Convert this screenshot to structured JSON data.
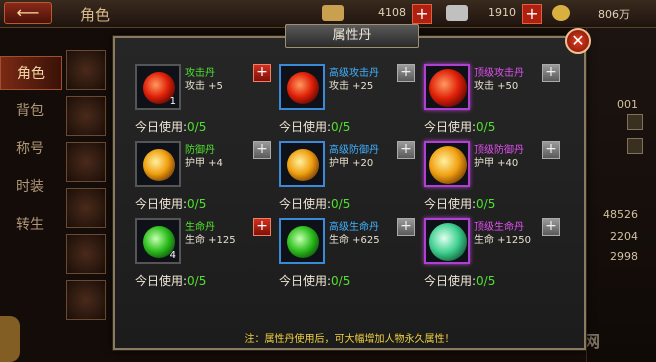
{
  "topbar": {
    "back_label": "⟵",
    "title": "角色",
    "resources": [
      {
        "icon": "gold-ingot-icon",
        "value": "4108"
      },
      {
        "icon": "silver-ingot-icon",
        "value": "1910"
      },
      {
        "icon": "copper-coin-icon",
        "value": "806万"
      }
    ],
    "plus_label": "+"
  },
  "sidenav": [
    "角色",
    "背包",
    "称号",
    "时装",
    "转生"
  ],
  "rightpanel": {
    "partial_text": "001",
    "numbers": [
      "48526",
      "2204",
      "2998"
    ]
  },
  "watermark": "九游手游网",
  "modal": {
    "title": "属性丹",
    "close_label": "✕",
    "usage_label": "今日使用:",
    "note": "注：属性丹使用后，可大幅增加人物永久属性！",
    "items": [
      {
        "name": "攻击丹",
        "stat": "攻击 +5",
        "usage": "0/5",
        "tier": "green",
        "orb": "red",
        "count": "1",
        "add": "red"
      },
      {
        "name": "高级攻击丹",
        "stat": "攻击 +25",
        "usage": "0/5",
        "tier": "blue",
        "orb": "red",
        "count": "",
        "add": "gray"
      },
      {
        "name": "顶级攻击丹",
        "stat": "攻击 +50",
        "usage": "0/5",
        "tier": "purple",
        "orb": "red",
        "count": "",
        "add": "gray"
      },
      {
        "name": "防御丹",
        "stat": "护甲 +4",
        "usage": "0/5",
        "tier": "green",
        "orb": "gold",
        "count": "",
        "add": "gray"
      },
      {
        "name": "高级防御丹",
        "stat": "护甲 +20",
        "usage": "0/5",
        "tier": "blue",
        "orb": "gold",
        "count": "",
        "add": "gray"
      },
      {
        "name": "顶级防御丹",
        "stat": "护甲 +40",
        "usage": "0/5",
        "tier": "purple",
        "orb": "gold",
        "count": "",
        "add": "gray"
      },
      {
        "name": "生命丹",
        "stat": "生命 +125",
        "usage": "0/5",
        "tier": "green",
        "orb": "green",
        "count": "4",
        "add": "red"
      },
      {
        "name": "高级生命丹",
        "stat": "生命 +625",
        "usage": "0/5",
        "tier": "blue",
        "orb": "green",
        "count": "",
        "add": "gray"
      },
      {
        "name": "顶级生命丹",
        "stat": "生命 +1250",
        "usage": "0/5",
        "tier": "purple",
        "orb": "teal",
        "count": "",
        "add": "gray"
      }
    ]
  }
}
